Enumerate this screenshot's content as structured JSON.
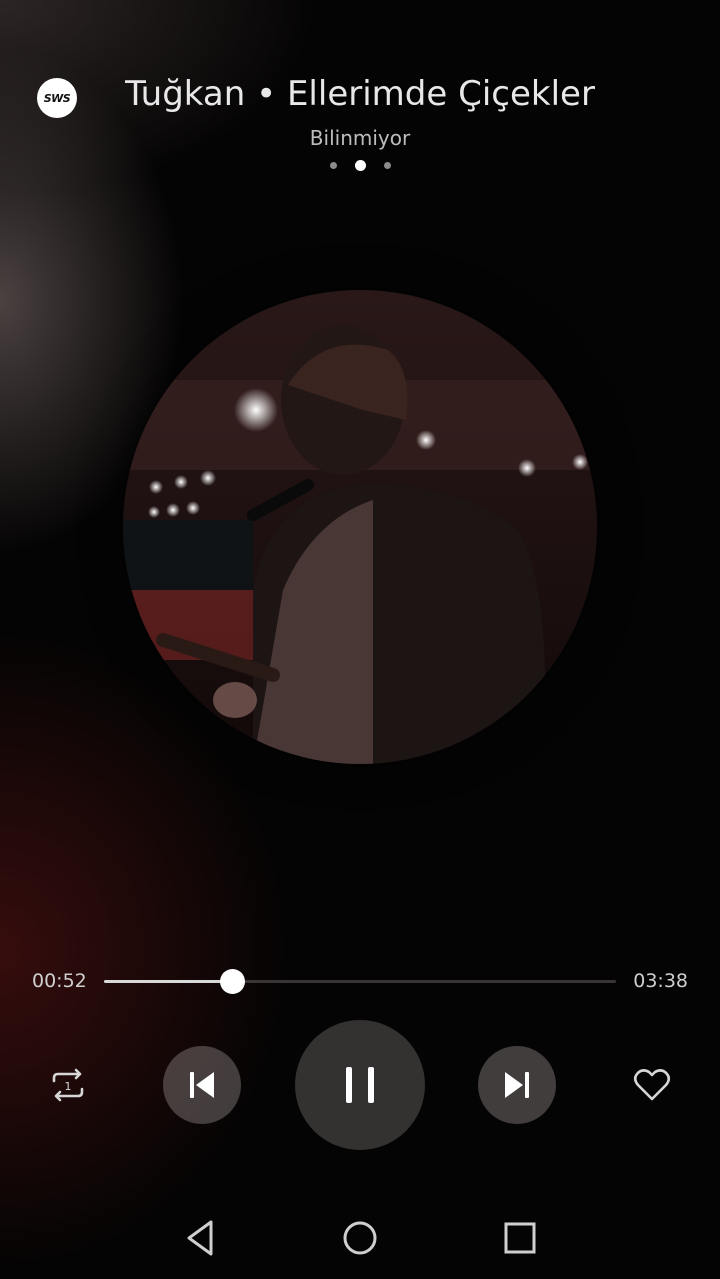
{
  "header": {
    "logo_text": "SWS",
    "title": "Tuğkan • Ellerimde Çiçekler",
    "artist": "Bilinmiyor",
    "page_dots": {
      "count": 3,
      "active_index": 1
    }
  },
  "album_art": {
    "icon": "album-art-photo"
  },
  "progress": {
    "current_time": "00:52",
    "total_time": "03:38",
    "fraction": 0.25
  },
  "controls": {
    "repeat_icon": "repeat-one-icon",
    "repeat_badge": "1",
    "previous_icon": "skip-previous-icon",
    "play_pause_icon": "pause-icon",
    "next_icon": "skip-next-icon",
    "favorite_icon": "heart-outline-icon"
  },
  "navbar": {
    "back_icon": "back-triangle-icon",
    "home_icon": "home-circle-icon",
    "recents_icon": "recents-square-icon"
  },
  "colors": {
    "background": "#050404",
    "accent_glow": "#5f1414",
    "text_primary": "#e8e8e8",
    "text_secondary": "#bdbdbd"
  }
}
